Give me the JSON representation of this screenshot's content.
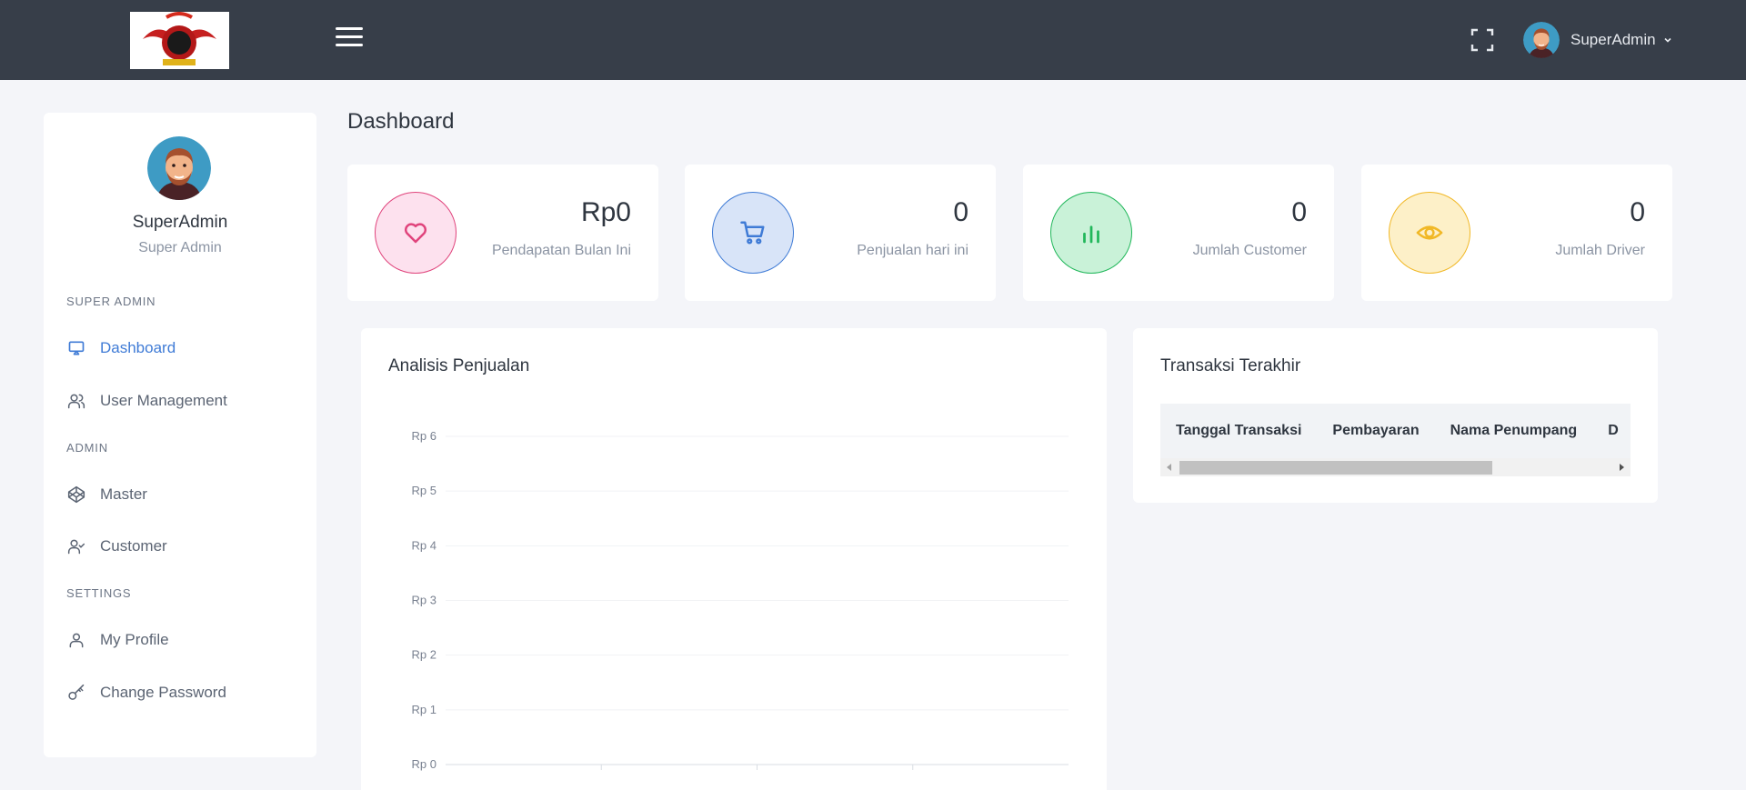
{
  "header": {
    "user_name": "SuperAdmin"
  },
  "sidebar": {
    "profile_name": "SuperAdmin",
    "profile_role": "Super Admin",
    "sections": [
      {
        "label": "SUPER ADMIN",
        "items": [
          {
            "label": "Dashboard",
            "icon": "monitor-icon",
            "active": true
          },
          {
            "label": "User Management",
            "icon": "users-icon"
          }
        ]
      },
      {
        "label": "ADMIN",
        "items": [
          {
            "label": "Master",
            "icon": "codepen-icon"
          },
          {
            "label": "Customer",
            "icon": "user-check-icon"
          }
        ]
      },
      {
        "label": "SETTINGS",
        "items": [
          {
            "label": "My Profile",
            "icon": "user-icon"
          },
          {
            "label": "Change Password",
            "icon": "key-icon"
          }
        ]
      }
    ]
  },
  "page": {
    "title": "Dashboard"
  },
  "stats": [
    {
      "value": "Rp0",
      "label": "Pendapatan Bulan Ini",
      "icon": "heart-icon",
      "color": "#e0447c",
      "bg": "#fde1ee"
    },
    {
      "value": "0",
      "label": "Penjualan hari ini",
      "icon": "cart-icon",
      "color": "#3f7bd6",
      "bg": "#d8e4f8"
    },
    {
      "value": "0",
      "label": "Jumlah Customer",
      "icon": "bar-chart-icon",
      "color": "#20b75a",
      "bg": "#c9f2d8"
    },
    {
      "value": "0",
      "label": "Jumlah Driver",
      "icon": "eye-icon",
      "color": "#f1b826",
      "bg": "#fdf0c8"
    }
  ],
  "chart": {
    "title": "Analisis Penjualan"
  },
  "chart_data": {
    "type": "line",
    "title": "Analisis Penjualan",
    "y_tick_labels": [
      "Rp 0",
      "Rp 1",
      "Rp 2",
      "Rp 3",
      "Rp 4",
      "Rp 5",
      "Rp 6"
    ],
    "ylim": [
      0,
      6
    ],
    "grid": true,
    "series": []
  },
  "transactions": {
    "title": "Transaksi Terakhir",
    "columns": [
      "Tanggal Transaksi",
      "Pembayaran",
      "Nama Penumpang",
      "D"
    ]
  }
}
